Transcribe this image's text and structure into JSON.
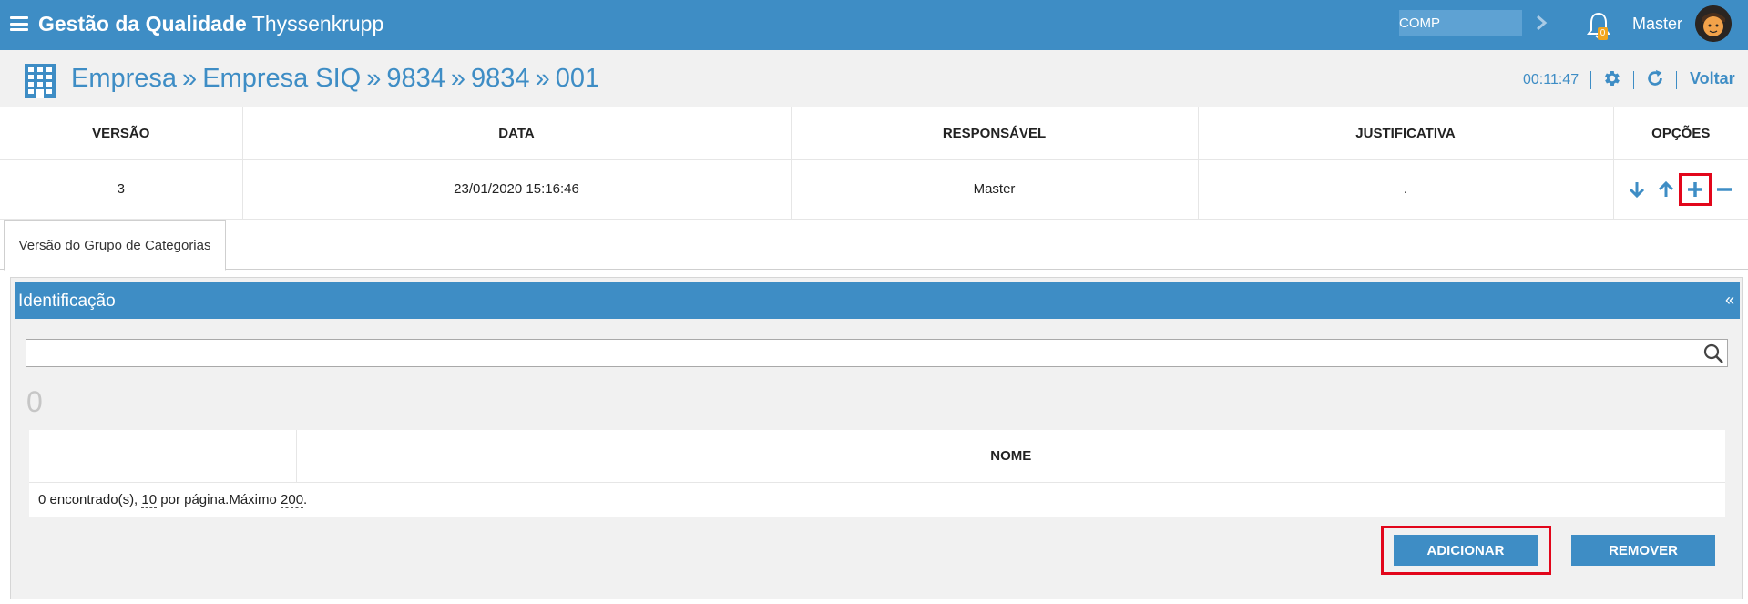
{
  "header": {
    "title_bold": "Gestão da Qualidade",
    "title_rest": "Thyssenkrupp",
    "search_value": "COMP",
    "notification_count": "0",
    "user_name": "Master"
  },
  "breadcrumb": {
    "items": [
      "Empresa",
      "Empresa SIQ",
      "9834",
      "9834",
      "001"
    ],
    "separator": "»"
  },
  "toolbar": {
    "timer": "00:11:47",
    "back_label": "Voltar"
  },
  "versions_table": {
    "columns": [
      "VERSÃO",
      "DATA",
      "RESPONSÁVEL",
      "JUSTIFICATIVA",
      "OPÇÕES"
    ],
    "rows": [
      {
        "version": "3",
        "date": "23/01/2020 15:16:46",
        "responsible": "Master",
        "justification": "."
      }
    ],
    "options_icons": [
      "arrow-down-icon",
      "arrow-up-icon",
      "plus-icon",
      "minus-icon"
    ]
  },
  "tabs": [
    {
      "label": "Versão do Grupo de Categorias"
    }
  ],
  "panel": {
    "title": "Identificação",
    "collapse_symbol": "«",
    "filter_value": "",
    "count": "0",
    "table_columns": [
      "",
      "NOME"
    ],
    "footer": {
      "found": "0 encontrado(s),",
      "per_page_value": "10",
      "per_page_text": "por página.Máximo",
      "max_value": "200",
      "end": "."
    },
    "add_label": "ADICIONAR",
    "remove_label": "REMOVER"
  },
  "colors": {
    "primary": "#3e8dc5",
    "highlight": "#e2061b",
    "badge": "#f2a51e",
    "background_light": "#f1f1f1"
  }
}
